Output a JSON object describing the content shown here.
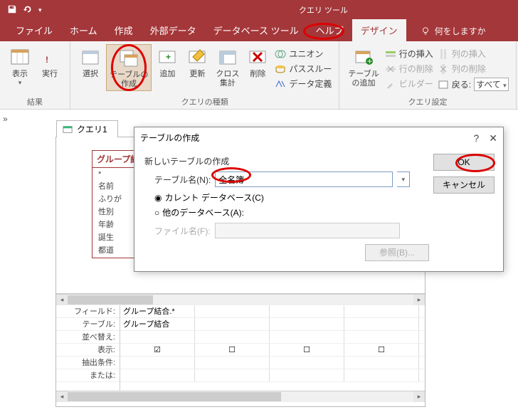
{
  "titlebar": {
    "tool_tab": "クエリ ツール"
  },
  "tabs": {
    "file": "ファイル",
    "home": "ホーム",
    "create": "作成",
    "external": "外部データ",
    "dbtools": "データベース ツール",
    "help": "ヘルプ",
    "design": "デザイン",
    "tell": "何をしますか"
  },
  "ribbon": {
    "group_results": "結果",
    "group_querytype": "クエリの種類",
    "group_querysetup": "クエリ設定",
    "view": "表示",
    "run": "実行",
    "select": "選択",
    "make_table": "テーブルの\n作成",
    "append": "追加",
    "update": "更新",
    "crosstab": "クロス\n集計",
    "delete": "削除",
    "union": "ユニオン",
    "passthrough": "パススルー",
    "datadef": "データ定義",
    "add_table": "テーブル\nの追加",
    "insert_row": "行の挿入",
    "delete_row": "行の削除",
    "builder": "ビルダー",
    "insert_col": "列の挿入",
    "delete_col": "列の削除",
    "return": "戻る:",
    "return_value": "すべて"
  },
  "query_tab": "クエリ1",
  "table_box": {
    "header": "グループ結",
    "fields": [
      "*",
      "名前",
      "ふりが",
      "性別",
      "年齢",
      "誕生",
      "都道"
    ]
  },
  "grid": {
    "labels": [
      "フィールド:",
      "テーブル:",
      "並べ替え:",
      "表示:",
      "抽出条件:",
      "または:"
    ],
    "row_field": [
      "グループ結合.*",
      "",
      "",
      ""
    ],
    "row_table": [
      "グループ結合",
      "",
      "",
      ""
    ],
    "row_show": [
      "☑",
      "☐",
      "☐",
      "☐"
    ]
  },
  "dialog": {
    "title": "テーブルの作成",
    "section": "新しいテーブルの作成",
    "table_name_label": "テーブル名(N):",
    "table_name_value": "全名簿",
    "radio_current": "カレント データベース(C)",
    "radio_other": "他のデータベース(A):",
    "file_label": "ファイル名(F):",
    "browse": "参照(B)...",
    "ok": "OK",
    "cancel": "キャンセル"
  }
}
